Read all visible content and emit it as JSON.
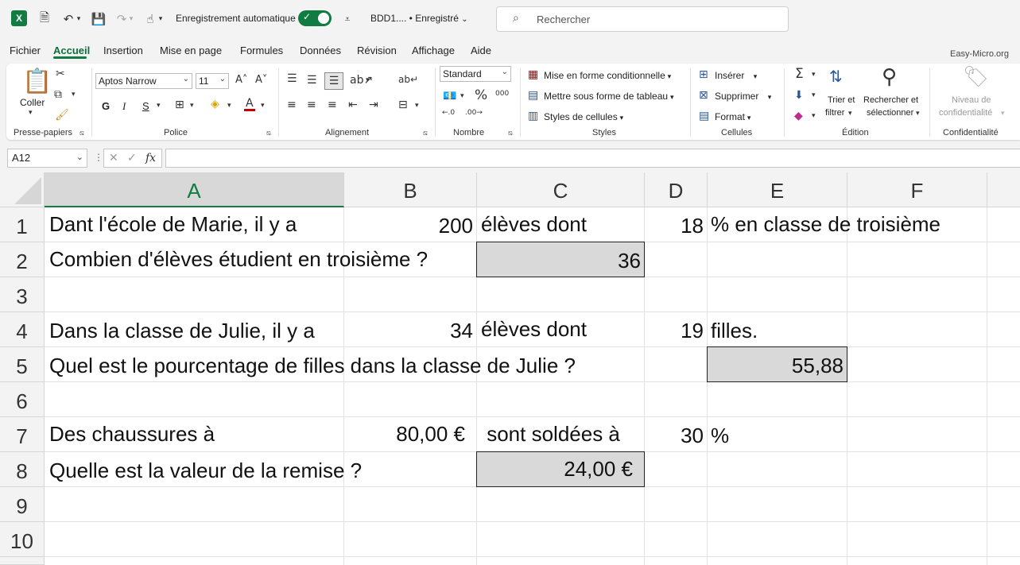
{
  "titlebar": {
    "autosave_label": "Enregistrement automatique",
    "filename": "BDD1....  •  Enregistré",
    "search_placeholder": "Rechercher"
  },
  "menu": {
    "items": [
      "Fichier",
      "Accueil",
      "Insertion",
      "Mise en page",
      "Formules",
      "Données",
      "Révision",
      "Affichage",
      "Aide"
    ],
    "active": "Accueil",
    "brand": "Easy-Micro.org"
  },
  "ribbon": {
    "clipboard": {
      "paste": "Coller",
      "label": "Presse-papiers"
    },
    "font": {
      "name": "Aptos Narrow",
      "size": "11",
      "bold": "G",
      "italic": "I",
      "underline": "S",
      "label": "Police"
    },
    "alignment": {
      "label": "Alignement"
    },
    "number": {
      "format": "Standard",
      "label": "Nombre"
    },
    "styles": {
      "conditional": "Mise en forme conditionnelle",
      "table": "Mettre sous forme de tableau",
      "cell_styles": "Styles de cellules",
      "label": "Styles"
    },
    "cells": {
      "insert": "Insérer",
      "delete": "Supprimer",
      "format": "Format",
      "label": "Cellules"
    },
    "editing": {
      "sort_line1": "Trier et",
      "sort_line2": "filtrer",
      "find_line1": "Rechercher et",
      "find_line2": "sélectionner",
      "label": "Édition"
    },
    "sensitivity": {
      "line1": "Niveau de",
      "line2": "confidentialité",
      "label": "Confidentialité"
    }
  },
  "formula_bar": {
    "name_box": "A12",
    "formula": ""
  },
  "sheet": {
    "columns": [
      "A",
      "B",
      "C",
      "D",
      "E",
      "F"
    ],
    "selected_column": "A",
    "rows": [
      "1",
      "2",
      "3",
      "4",
      "5",
      "6",
      "7",
      "8",
      "9",
      "10"
    ],
    "cells": {
      "A1": "Dant l'école de Marie, il y a",
      "B1": "200",
      "C1": "élèves dont",
      "D1": "18",
      "E1": "% en classe de troisième",
      "A2": "Combien d'élèves étudient en troisième ?",
      "C2": "36",
      "A4": "Dans la classe de Julie, il y a",
      "B4": "34",
      "C4": "élèves dont",
      "D4": "19",
      "E4": "filles.",
      "A5": "Quel est le pourcentage de filles dans la classe de Julie ?",
      "E5": "55,88",
      "A7": "Des chaussures à",
      "B7": "80,00 €",
      "C7": " sont soldées à",
      "D7": "30",
      "E7": "%",
      "A8": "Quelle est la valeur de la remise ?",
      "C8": "24,00 €"
    },
    "highlight_color": "#d9d9d9"
  },
  "colors": {
    "accent": "#107c41"
  }
}
